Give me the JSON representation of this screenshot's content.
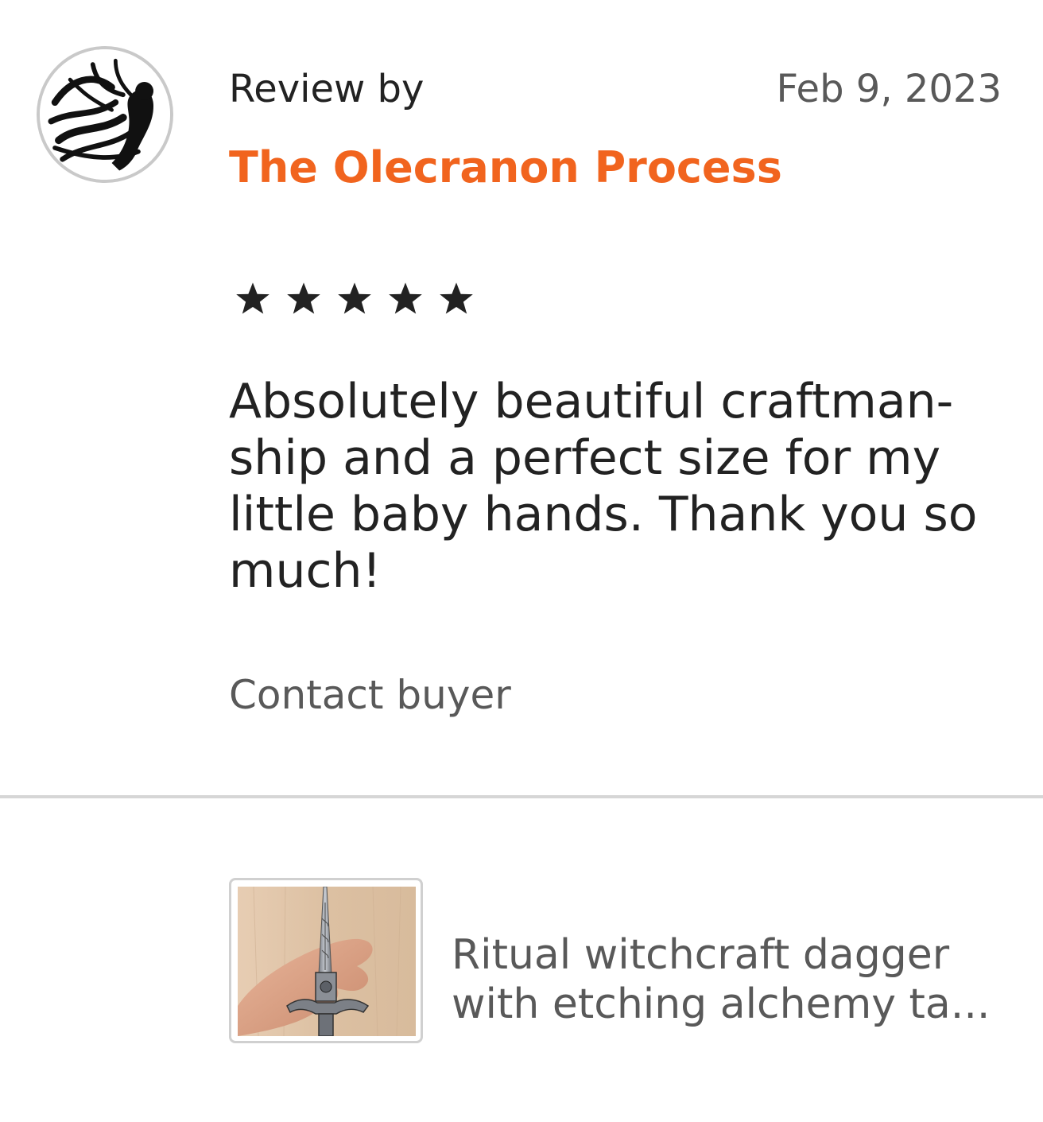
{
  "review": {
    "label": "Review by",
    "date": "Feb 9, 2023",
    "reviewer_name": "The Olecranon Process",
    "rating": 5,
    "text_lines": [
      "Absolutely beautiful craftman-",
      "ship and a perfect size for my",
      "little baby hands. Thank you so",
      "much!"
    ],
    "contact_label": "Contact buyer"
  },
  "listing": {
    "title_lines": [
      "Ritual witchcraft dagger",
      "with etching alchemy ta..."
    ]
  },
  "colors": {
    "accent": "#f1641e",
    "text": "#222222",
    "muted": "#595959",
    "divider": "#d6d6d6"
  }
}
